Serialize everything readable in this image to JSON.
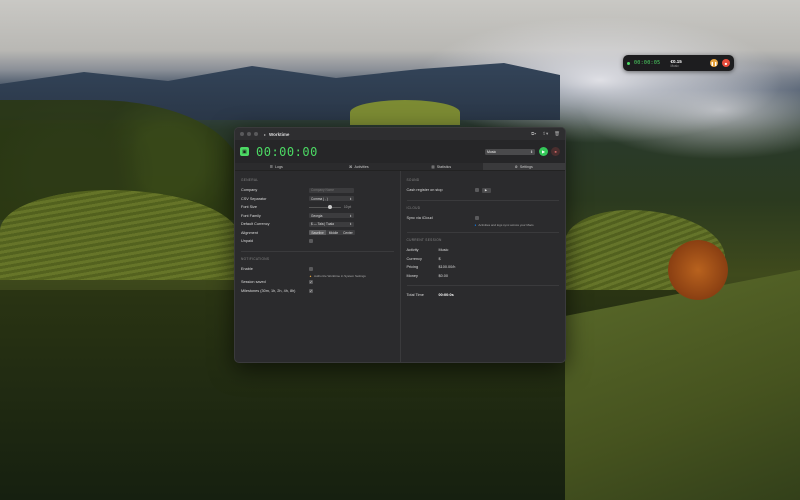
{
  "mini_widget": {
    "time": "00:00:05",
    "amount": "€0.15",
    "label": "Music",
    "pause_icon": "pause-icon",
    "stop_icon": "stop-icon"
  },
  "window": {
    "title": "Worktime",
    "toolbar_icons": [
      "copy-icon",
      "share-icon",
      "trash-icon"
    ]
  },
  "timer": {
    "time": "00:00:00",
    "activity": "Music",
    "colors": {
      "accent": "#4cd964",
      "play": "#34c759",
      "stop": "#e74c3c"
    }
  },
  "tabs": [
    {
      "label": "Logs",
      "icon": "list-icon"
    },
    {
      "label": "Activities",
      "icon": "activities-icon"
    },
    {
      "label": "Statistics",
      "icon": "chart-icon"
    },
    {
      "label": "Settings",
      "icon": "gear-icon",
      "active": true
    }
  ],
  "settings": {
    "general": {
      "heading": "GENERAL",
      "company_label": "Company",
      "company_placeholder": "Company Name",
      "csv_label": "CSV Separator",
      "csv_value": "Comma ( , )",
      "font_size_label": "Font Size",
      "font_size_value": "10 pt",
      "font_family_label": "Font Family",
      "font_family_value": "Georgia",
      "currency_label": "Default Currency",
      "currency_value": "$ — Tala | Tuala",
      "alignment_label": "Alignment",
      "alignment_options": [
        "Baseline",
        "Middle",
        "Center"
      ],
      "unpaid_label": "Unpaid"
    },
    "notifications": {
      "heading": "NOTIFICATIONS",
      "enable_label": "Enable",
      "enable_note": "Authorize Worktime in System Settings",
      "session_label": "Session saved",
      "milestones_label": "Milestones (30m, 1h, 2h, 4h, 8h)"
    },
    "sound": {
      "heading": "SOUND",
      "cash_label": "Cash register on stop"
    },
    "icloud": {
      "heading": "ICLOUD",
      "sync_label": "Sync via iCloud",
      "sync_note": "Activities and logs sync across your Macs"
    },
    "current_session": {
      "heading": "CURRENT SESSION",
      "rows": [
        {
          "label": "Activity",
          "value": "Music"
        },
        {
          "label": "Currency",
          "value": "$"
        },
        {
          "label": "Pricing",
          "value": "$100.00/h"
        },
        {
          "label": "Money",
          "value": "$0.00"
        }
      ],
      "total_label": "Total Time",
      "total_value": "00:00:0s"
    }
  }
}
